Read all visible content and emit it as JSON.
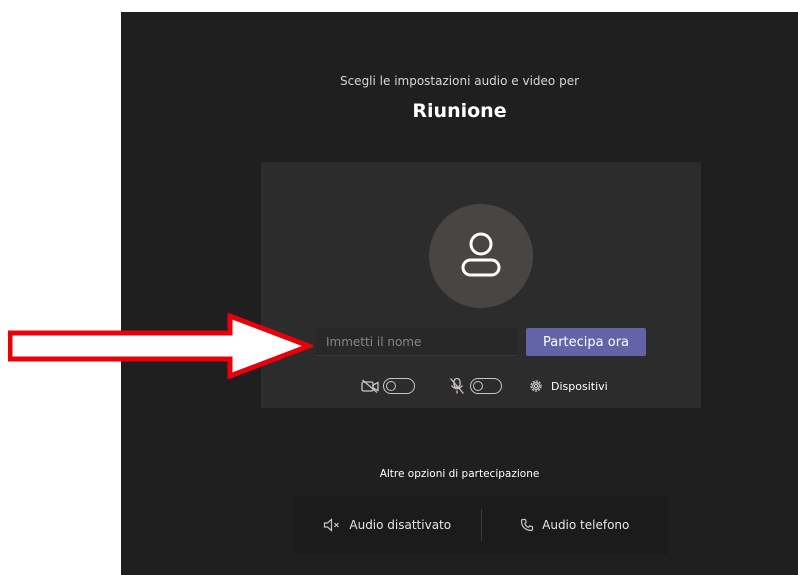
{
  "header": {
    "subtitle": "Scegli le impostazioni audio e video per",
    "meeting_title": "Riunione"
  },
  "prejoin": {
    "name_placeholder": "Immetti il nome",
    "name_value": "",
    "join_button": "Partecipa ora",
    "camera_toggle_on": false,
    "mic_toggle_on": false,
    "devices_label": "Dispositivi"
  },
  "other_options": {
    "title": "Altre opzioni di partecipazione",
    "audio_off": "Audio disattivato",
    "phone_audio": "Audio telefono"
  },
  "icons": {
    "avatar": "person-icon",
    "camera": "camera-off-icon",
    "mic": "mic-off-icon",
    "devices": "gear-icon",
    "audio_off": "speaker-off-icon",
    "phone": "phone-icon",
    "annotation": "arrow-right-icon"
  },
  "colors": {
    "background": "#1f1f1f",
    "panel": "#2d2c2c",
    "accent": "#6264a7",
    "annotation_arrow": "#e8000b"
  }
}
